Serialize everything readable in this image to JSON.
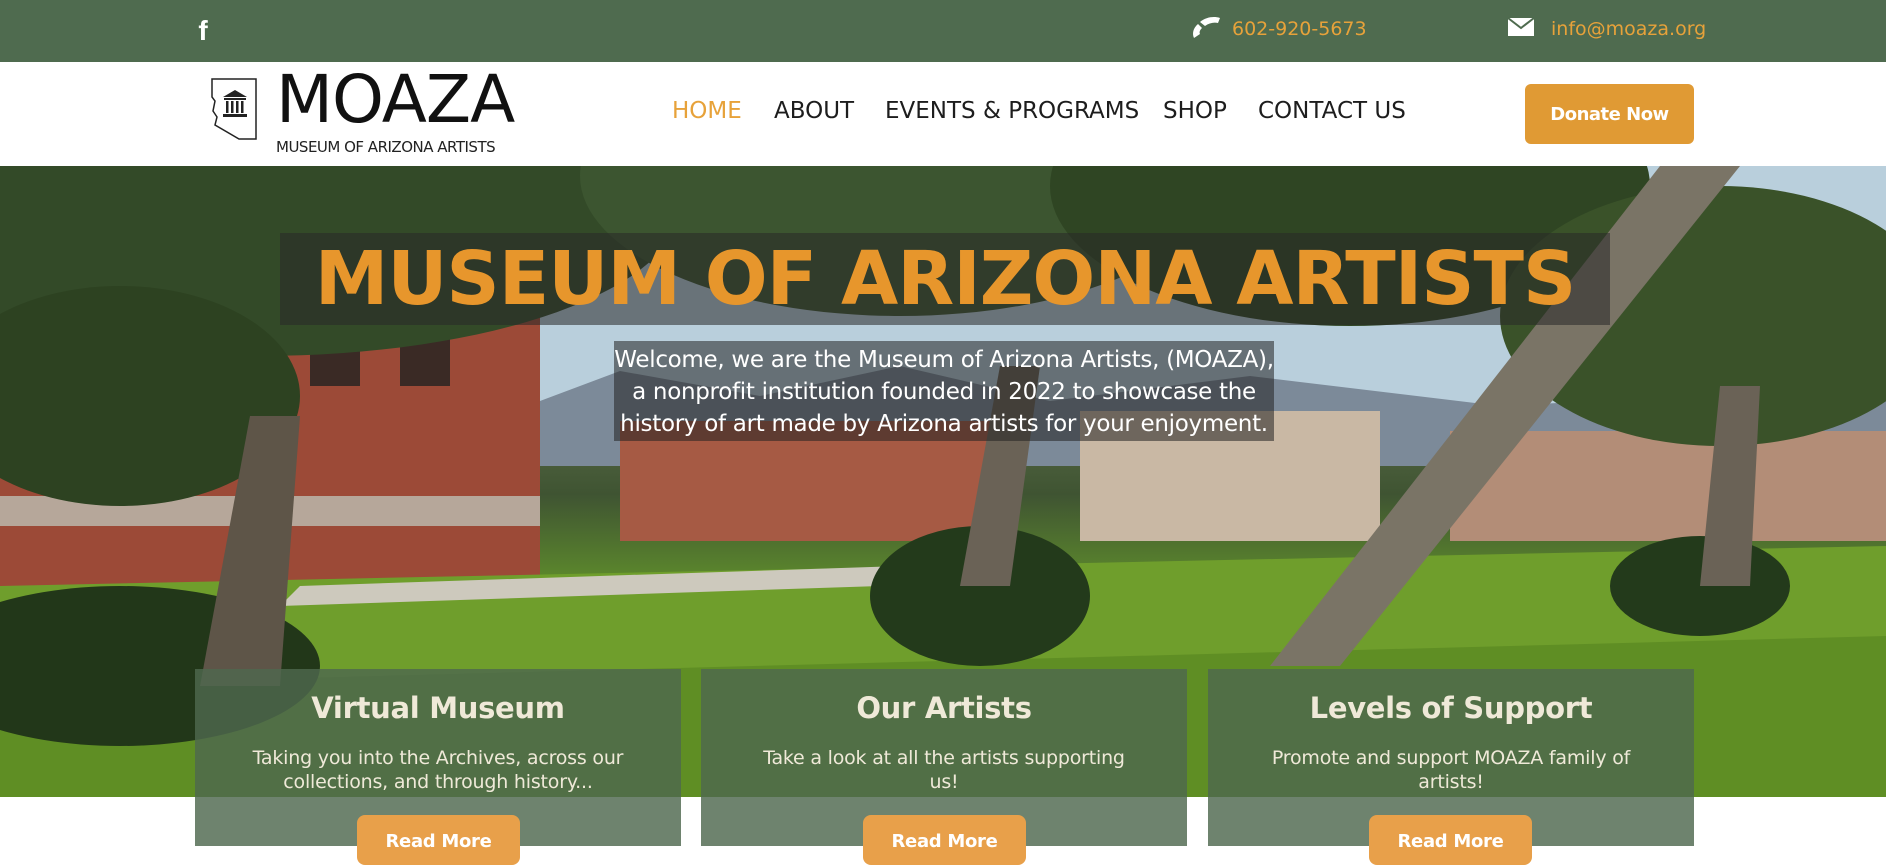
{
  "topbar": {
    "facebook_icon": "facebook-icon",
    "phone_icon": "phone-icon",
    "phone": "602-920-5673",
    "email_icon": "envelope-icon",
    "email": "info@moaza.org"
  },
  "header": {
    "logo_icon": "arizona-museum-logo-icon",
    "logo_word": "MOAZA",
    "logo_sub": "MUSEUM OF ARIZONA ARTISTS",
    "nav": [
      "HOME",
      "ABOUT",
      "EVENTS & PROGRAMS",
      "SHOP",
      "CONTACT US"
    ],
    "active_nav": "HOME",
    "donate_label": "Donate Now"
  },
  "hero": {
    "title": "MUSEUM OF ARIZONA ARTISTS",
    "welcome_lines": [
      "Welcome, we are the Museum of Arizona Artists, (MOAZA),",
      "a nonprofit institution founded in 2022 to showcase the",
      "history of art made by Arizona artists for your enjoyment."
    ]
  },
  "cards": [
    {
      "title": "Virtual Museum",
      "text_lines": [
        "Taking you into the Archives, across our",
        "collections, and through history..."
      ],
      "button": "Read More"
    },
    {
      "title": "Our Artists",
      "text_lines": [
        "Take a look at all the artists supporting",
        "us!"
      ],
      "button": "Read More"
    },
    {
      "title": "Levels of Support",
      "text_lines": [
        "Promote and support MOAZA family of",
        "artists!"
      ],
      "button": "Read More"
    }
  ],
  "colors": {
    "topbar": "#4f6b4f",
    "accent": "#e7a23a",
    "donate": "#e09a34",
    "card_overlay": "#4e684e",
    "hero_title": "#e7962c"
  }
}
